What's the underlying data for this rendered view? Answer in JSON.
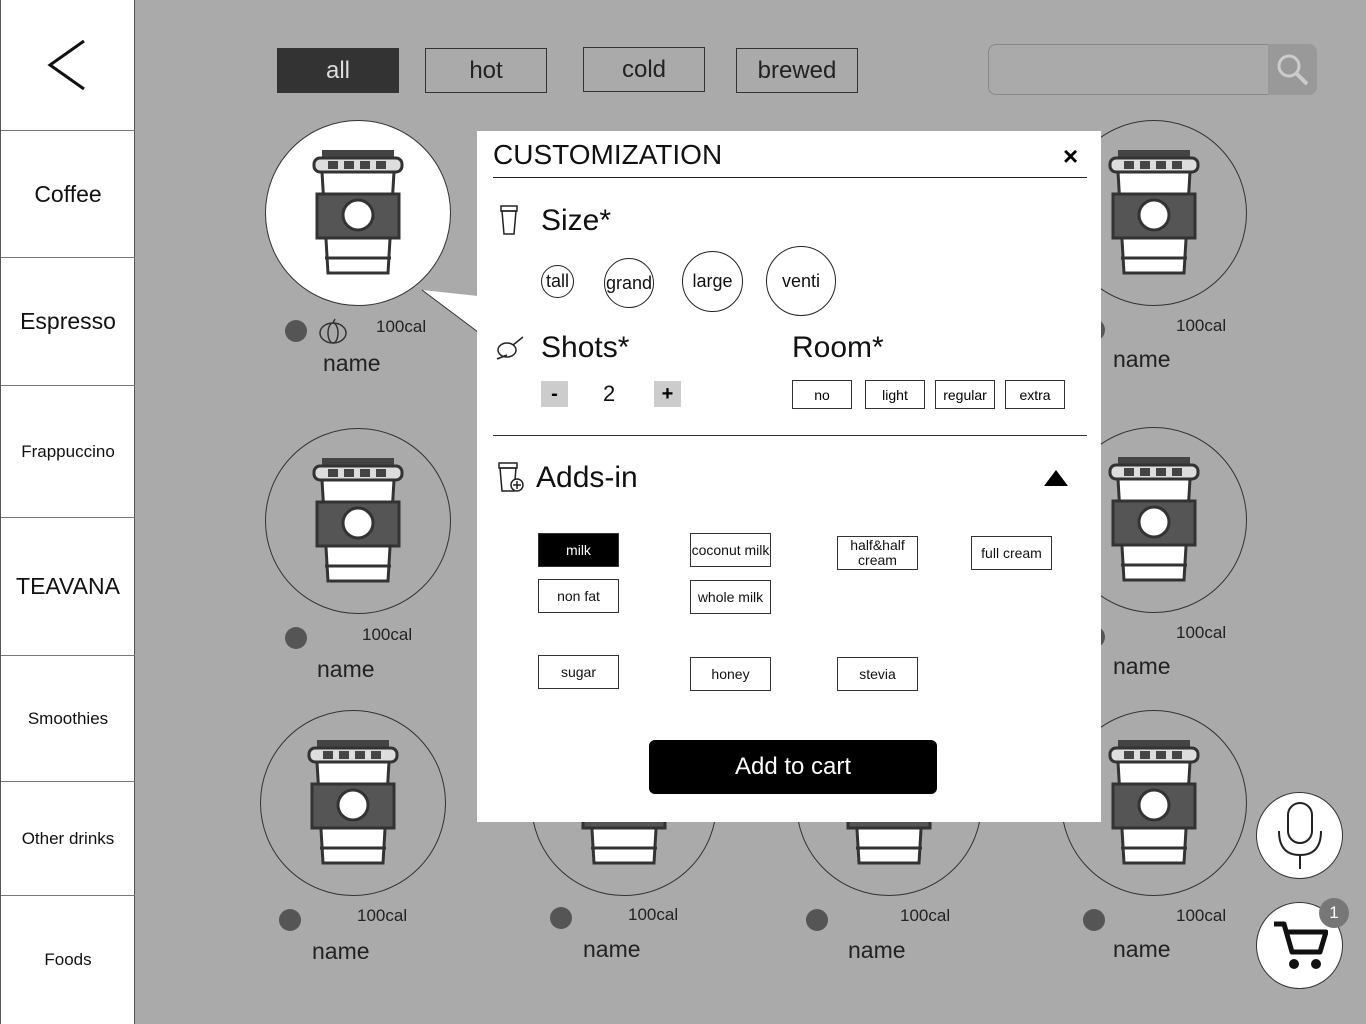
{
  "sidebar": {
    "back_icon": "chevron-left-icon",
    "items": [
      {
        "label": "Coffee"
      },
      {
        "label": "Espresso"
      },
      {
        "label": "Frappuccino"
      },
      {
        "label": "TEAVANA"
      },
      {
        "label": "Smoothies"
      },
      {
        "label": "Other drinks"
      },
      {
        "label": "Foods"
      }
    ]
  },
  "filters": {
    "items": [
      {
        "label": "all",
        "active": true
      },
      {
        "label": "hot"
      },
      {
        "label": "cold"
      },
      {
        "label": "brewed"
      }
    ]
  },
  "search": {
    "placeholder": "",
    "icon": "search-icon"
  },
  "drinks": [
    {
      "name": "name",
      "calories": "100cal"
    },
    {
      "name": "name",
      "calories": "100cal"
    },
    {
      "name": "name",
      "calories": "100cal"
    },
    {
      "name": "name",
      "calories": "100cal"
    },
    {
      "name": "name",
      "calories": "100cal"
    },
    {
      "name": "name",
      "calories": "100cal"
    },
    {
      "name": "name",
      "calories": "100cal"
    },
    {
      "name": "name",
      "calories": "100cal"
    },
    {
      "name": "name",
      "calories": "100cal"
    }
  ],
  "cart": {
    "badge": "1"
  },
  "modal": {
    "title": "CUSTOMIZATION",
    "close": "×",
    "size": {
      "label": "Size*",
      "options": [
        "tall",
        "grand",
        "large",
        "venti"
      ]
    },
    "shots": {
      "label": "Shots*",
      "minus": "-",
      "value": "2",
      "plus": "+"
    },
    "room": {
      "label": "Room*",
      "options": [
        "no",
        "light",
        "regular",
        "extra"
      ]
    },
    "adds_in": {
      "label": "Adds-in",
      "options": {
        "milk": "milk",
        "coconut_milk": "coconut milk",
        "half_half": "half&half cream",
        "full_cream": "full cream",
        "non_fat": "non fat",
        "whole_milk": "whole milk",
        "sugar": "sugar",
        "honey": "honey",
        "stevia": "stevia"
      },
      "selected": "milk"
    },
    "add_to_cart": "Add to cart"
  }
}
